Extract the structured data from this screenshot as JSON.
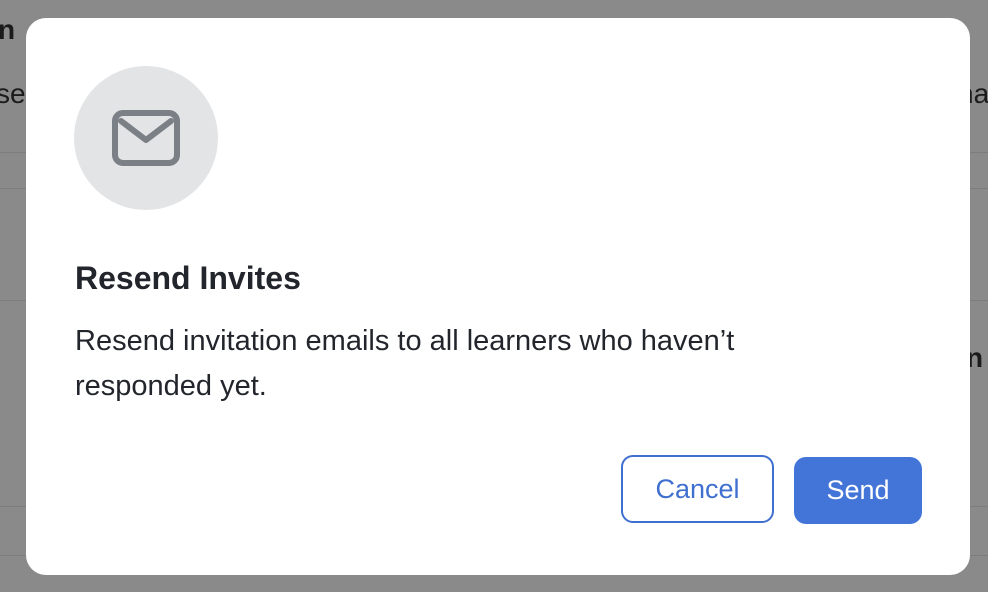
{
  "background": {
    "fragments": [
      "n",
      "se",
      "na",
      "n"
    ]
  },
  "dialog": {
    "icon": "envelope-icon",
    "title": "Resend Invites",
    "message": "Resend invitation emails to all learners who haven’t responded yet.",
    "cancel_label": "Cancel",
    "send_label": "Send"
  },
  "colors": {
    "accent": "#4375d8",
    "overlay": "#8a8a8a",
    "icon_circle": "#e3e4e6",
    "icon_stroke": "#7b7f86"
  }
}
